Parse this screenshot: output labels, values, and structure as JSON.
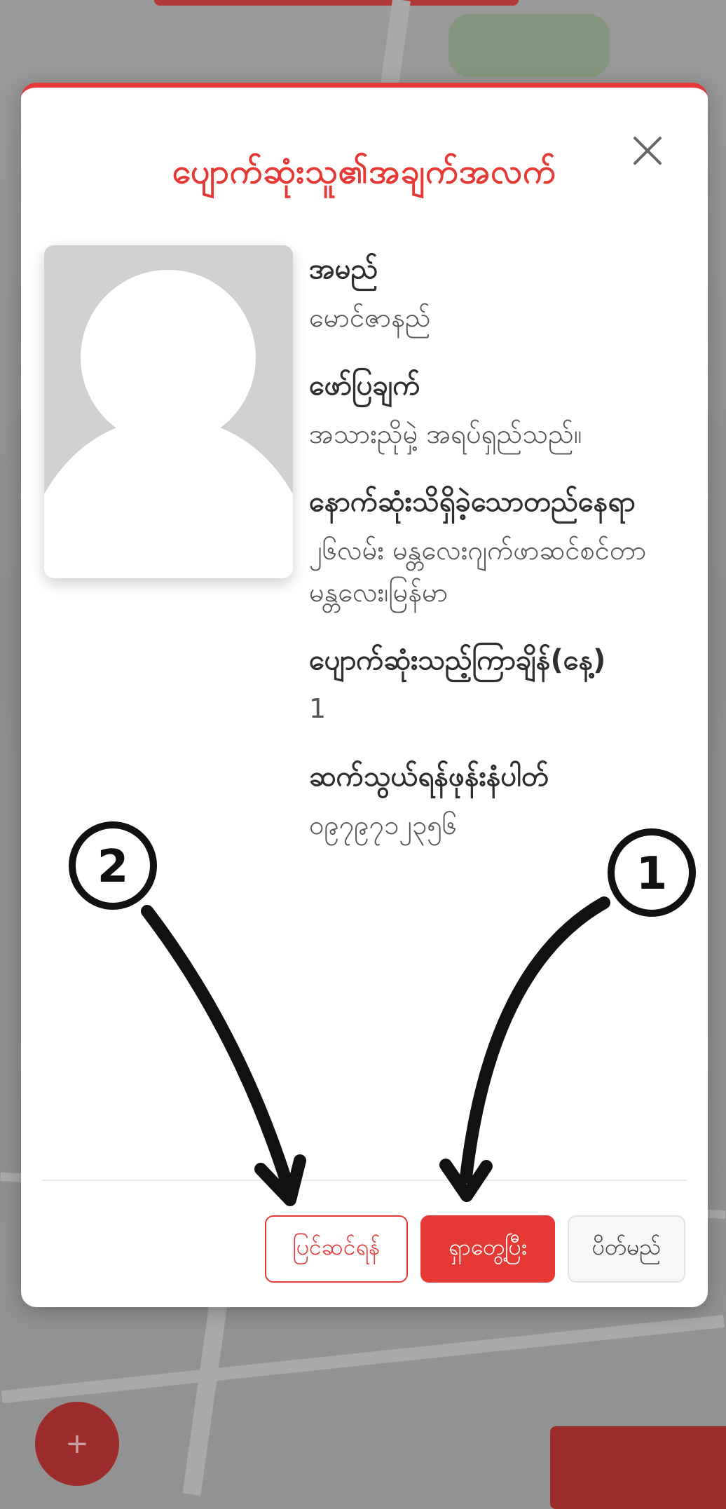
{
  "modal": {
    "title": "ပျောက်ဆုံးသူ၏အချက်အလက်",
    "fields": [
      {
        "label": "အမည်",
        "value": "မောင်ဇာနည်"
      },
      {
        "label": "ဖော်ပြချက်",
        "value": "အသားညိုမှဲ့ အရပ်ရှည်သည်။"
      },
      {
        "label": "နောက်ဆုံးသိရှိခဲ့သောတည်နေရာ",
        "value": "၂၆လမ်း မန္တလေးဂျက်ဖာဆင်စင်တာ မန္တလေး၊မြန်မာ"
      },
      {
        "label": "ပျောက်ဆုံးသည့်ကြာချိန်(နေ့)",
        "value": "1"
      },
      {
        "label": "ဆက်သွယ်ရန်ဖုန်းနံပါတ်",
        "value": "၀၉၇၉၇၁၂၃၅၆"
      }
    ],
    "buttons": {
      "edit": "ပြင်ဆင်ရန်",
      "found": "ရှာတွေ့ပြီး",
      "close": "ပိတ်မည်"
    }
  },
  "annotations": {
    "marker_1": "1",
    "marker_2": "2"
  },
  "colors": {
    "accent": "#e53935",
    "text": "#333333",
    "overlay": "#8d8d8d"
  }
}
